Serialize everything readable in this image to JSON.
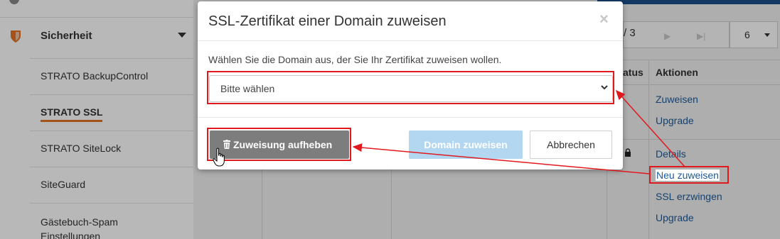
{
  "sidebar": {
    "section_label": "Sicherheit",
    "items": [
      {
        "label": "STRATO BackupControl",
        "active": false
      },
      {
        "label": "STRATO SSL",
        "active": true
      },
      {
        "label": "STRATO SiteLock",
        "active": false
      },
      {
        "label": "SiteGuard",
        "active": false
      },
      {
        "label": "Gästebuch-Spam Einstellungen",
        "active": false
      }
    ]
  },
  "pager": {
    "page_text": "/ 3",
    "per_page": "6"
  },
  "table": {
    "headers": {
      "status": "atus",
      "actions": "Aktionen"
    },
    "row1_actions": [
      "Zuweisen",
      "Upgrade"
    ],
    "row2_actions": [
      "Details",
      "Neu zuweisen",
      "SSL erzwingen",
      "Upgrade"
    ]
  },
  "modal": {
    "title": "SSL-Zertifikat einer Domain zuweisen",
    "close": "×",
    "instruction": "Wählen Sie die Domain aus, der Sie Ihr Zertifikat zuweisen wollen.",
    "select_value": "Bitte wählen",
    "unassign_label": "Zuweisung aufheben",
    "assign_label": "Domain zuweisen",
    "cancel_label": "Abbrechen"
  },
  "colors": {
    "accent_orange": "#e37222",
    "link_blue": "#1c5b9a",
    "highlight_red": "#e0191f",
    "assign_button": "#b3d7f0"
  },
  "icons": [
    "shield-icon",
    "chevron-down-icon",
    "lock-icon",
    "trash-icon",
    "close-icon",
    "hand-cursor-icon"
  ]
}
